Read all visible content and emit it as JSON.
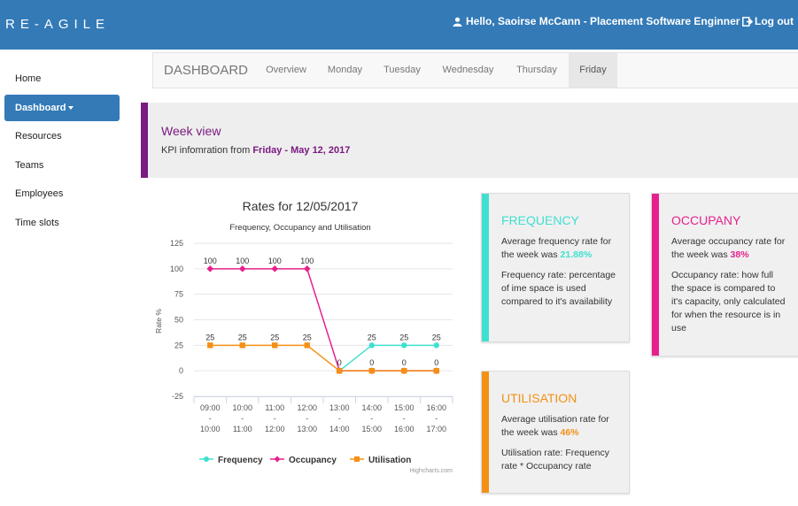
{
  "header": {
    "brand": "RE-AGILE",
    "greeting": "Hello, Saoirse McCann - Placement Software Enginner",
    "logout_label": "Log out"
  },
  "sidebar": {
    "items": [
      {
        "label": "Home"
      },
      {
        "label": "Dashboard"
      },
      {
        "label": "Resources"
      },
      {
        "label": "Teams"
      },
      {
        "label": "Employees"
      },
      {
        "label": "Time slots"
      }
    ],
    "active_index": 1
  },
  "tabs": {
    "title": "DASHBOARD",
    "items": [
      {
        "label": "Overview"
      },
      {
        "label": "Monday"
      },
      {
        "label": "Tuesday"
      },
      {
        "label": "Wednesday"
      },
      {
        "label": "Thursday"
      },
      {
        "label": "Friday"
      }
    ],
    "active_index": 5
  },
  "week": {
    "title": "Week view",
    "prefix": "KPI infomration from",
    "day_date": "Friday - May 12, 2017"
  },
  "chart_data": {
    "type": "line",
    "title": "Rates for 12/05/2017",
    "subtitle": "Frequency, Occupancy and Utilisation",
    "ylabel": "Rate %",
    "xlabel": "",
    "ylim": [
      -25,
      125
    ],
    "yticks": [
      -25,
      0,
      25,
      50,
      75,
      100,
      125
    ],
    "categories": [
      [
        "09:00",
        "-",
        "10:00"
      ],
      [
        "10:00",
        "-",
        "11:00"
      ],
      [
        "11:00",
        "-",
        "12:00"
      ],
      [
        "12:00",
        "-",
        "13:00"
      ],
      [
        "13:00",
        "-",
        "14:00"
      ],
      [
        "14:00",
        "-",
        "15:00"
      ],
      [
        "15:00",
        "-",
        "16:00"
      ],
      [
        "16:00",
        "-",
        "17:00"
      ]
    ],
    "series": [
      {
        "name": "Frequency",
        "color": "#40e0d0",
        "marker": "circle",
        "values": [
          null,
          null,
          null,
          null,
          0,
          25,
          25,
          25
        ]
      },
      {
        "name": "Occupancy",
        "color": "#e6218d",
        "marker": "diamond",
        "values": [
          100,
          100,
          100,
          100,
          0,
          0,
          0,
          0
        ]
      },
      {
        "name": "Utilisation",
        "color": "#f39016",
        "marker": "square",
        "values": [
          25,
          25,
          25,
          25,
          0,
          0,
          0,
          0
        ]
      }
    ],
    "labels_top": [
      100,
      100,
      100,
      100,
      0,
      25,
      25,
      25
    ],
    "labels_bottom": [
      25,
      25,
      25,
      25,
      null,
      0,
      0,
      0
    ],
    "credit": "Highcharts.com",
    "legend": "bottom",
    "grid": true
  },
  "cards": {
    "frequency": {
      "title": "FREQUENCY",
      "color": "#40e0d0",
      "line1": "Average frequency rate for the week was",
      "value": "21.88%",
      "desc": "Frequency rate: percentage of ime space is used compared to it's availability"
    },
    "occupancy": {
      "title": "OCCUPANY",
      "color": "#e6218d",
      "line1": "Average occupancy rate for the week was",
      "value": "38%",
      "desc": "Occupancy rate: how full the space is compared to it's capacity, only calculated for when the resource is in use"
    },
    "utilisation": {
      "title": "UTILISATION",
      "color": "#f39016",
      "line1": "Average utilisation rate for the week was",
      "value": "46%",
      "desc": "Utilisation rate: Frequency rate * Occupancy rate"
    }
  }
}
